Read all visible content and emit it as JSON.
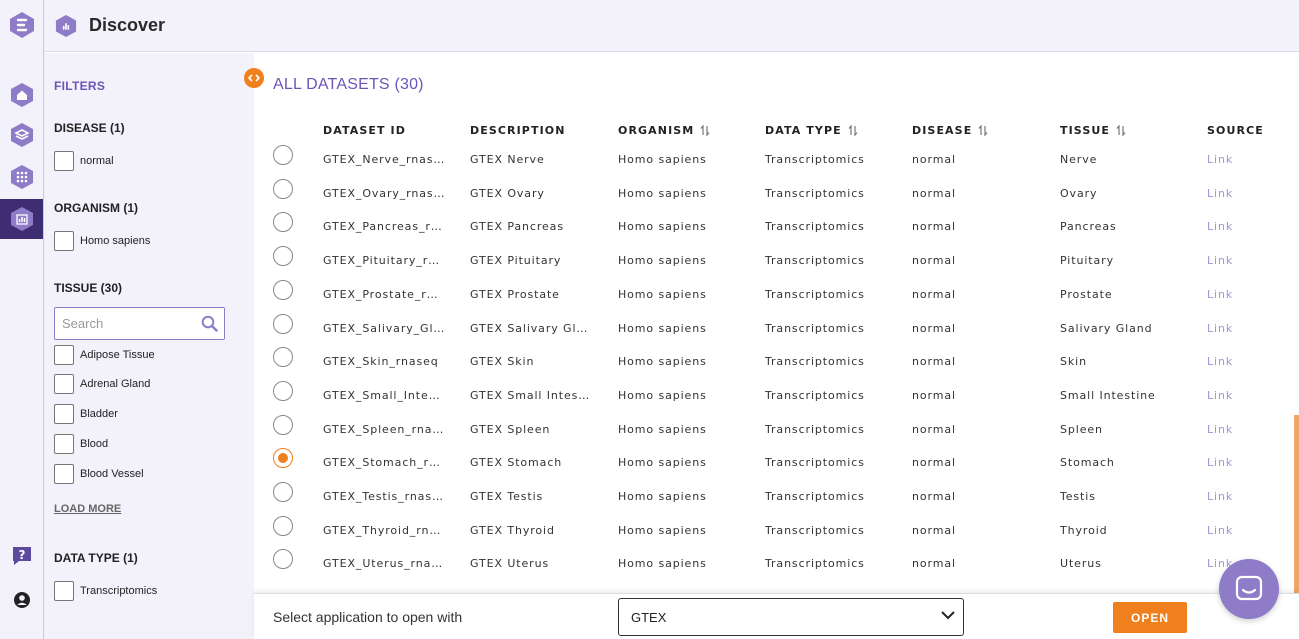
{
  "header": {
    "title": "Discover"
  },
  "filters": {
    "title": "FILTERS",
    "disease": {
      "title": "DISEASE (1)",
      "options": [
        "normal"
      ]
    },
    "organism": {
      "title": "ORGANISM (1)",
      "options": [
        "Homo sapiens"
      ]
    },
    "tissue": {
      "title": "TISSUE (30)",
      "search_placeholder": "Search",
      "options": [
        "Adipose Tissue",
        "Adrenal Gland",
        "Bladder",
        "Blood",
        "Blood Vessel"
      ],
      "load_more": "LOAD MORE"
    },
    "data_type": {
      "title": "DATA TYPE (1)",
      "options": [
        "Transcriptomics"
      ]
    }
  },
  "main": {
    "title": "ALL DATASETS (30)",
    "columns": [
      "DATASET ID",
      "DESCRIPTION",
      "ORGANISM",
      "DATA TYPE",
      "DISEASE",
      "TISSUE",
      "SOURCE"
    ],
    "rows": [
      [
        "GTEX_Nerve_rnas…",
        "GTEX Nerve",
        "Homo sapiens",
        "Transcriptomics",
        "normal",
        "Nerve",
        "Link"
      ],
      [
        "GTEX_Ovary_rnas…",
        "GTEX Ovary",
        "Homo sapiens",
        "Transcriptomics",
        "normal",
        "Ovary",
        "Link"
      ],
      [
        "GTEX_Pancreas_r…",
        "GTEX Pancreas",
        "Homo sapiens",
        "Transcriptomics",
        "normal",
        "Pancreas",
        "Link"
      ],
      [
        "GTEX_Pituitary_r…",
        "GTEX Pituitary",
        "Homo sapiens",
        "Transcriptomics",
        "normal",
        "Pituitary",
        "Link"
      ],
      [
        "GTEX_Prostate_r…",
        "GTEX Prostate",
        "Homo sapiens",
        "Transcriptomics",
        "normal",
        "Prostate",
        "Link"
      ],
      [
        "GTEX_Salivary_Gl…",
        "GTEX Salivary Gl…",
        "Homo sapiens",
        "Transcriptomics",
        "normal",
        "Salivary Gland",
        "Link"
      ],
      [
        "GTEX_Skin_rnaseq",
        "GTEX Skin",
        "Homo sapiens",
        "Transcriptomics",
        "normal",
        "Skin",
        "Link"
      ],
      [
        "GTEX_Small_Inte…",
        "GTEX Small Intes…",
        "Homo sapiens",
        "Transcriptomics",
        "normal",
        "Small Intestine",
        "Link"
      ],
      [
        "GTEX_Spleen_rna…",
        "GTEX Spleen",
        "Homo sapiens",
        "Transcriptomics",
        "normal",
        "Spleen",
        "Link"
      ],
      [
        "GTEX_Stomach_r…",
        "GTEX Stomach",
        "Homo sapiens",
        "Transcriptomics",
        "normal",
        "Stomach",
        "Link"
      ],
      [
        "GTEX_Testis_rnas…",
        "GTEX Testis",
        "Homo sapiens",
        "Transcriptomics",
        "normal",
        "Testis",
        "Link"
      ],
      [
        "GTEX_Thyroid_rn…",
        "GTEX Thyroid",
        "Homo sapiens",
        "Transcriptomics",
        "normal",
        "Thyroid",
        "Link"
      ],
      [
        "GTEX_Uterus_rna…",
        "GTEX Uterus",
        "Homo sapiens",
        "Transcriptomics",
        "normal",
        "Uterus",
        "Link"
      ]
    ],
    "selected_row": 9
  },
  "bottom_bar": {
    "label": "Select application to open with",
    "selected_app": "GTEX",
    "open_label": "OPEN"
  },
  "colors": {
    "accent": "#f07f1d",
    "brand": "#6b55b8",
    "rail_active": "#3e2d72"
  },
  "icons": [
    "logo-icon",
    "home-icon",
    "datasets-icon",
    "apps-grid-icon",
    "discover-icon",
    "help-icon",
    "account-icon",
    "search-icon",
    "sort-icon",
    "chevron-down-icon",
    "chat-icon"
  ]
}
